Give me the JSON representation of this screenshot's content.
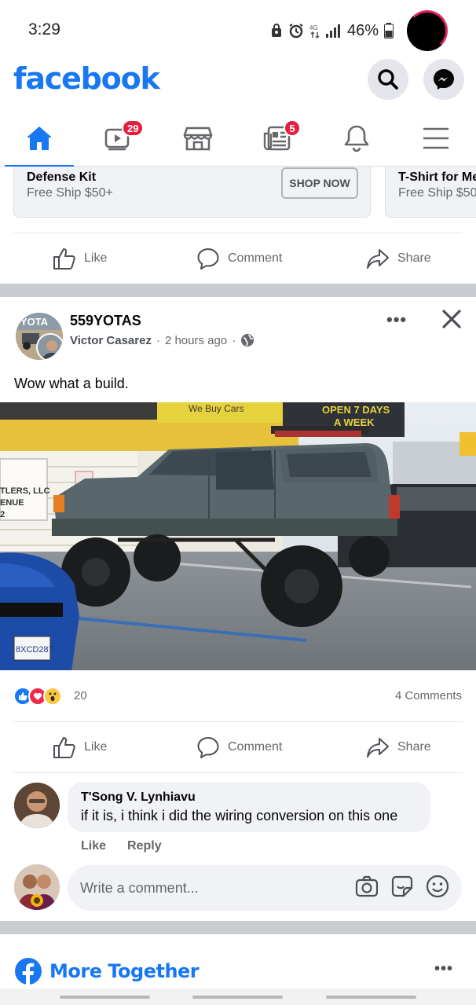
{
  "status_bar": {
    "time": "3:29",
    "battery": "46%",
    "icons": [
      "lock-icon",
      "alarm-icon",
      "data-icon",
      "signal-icon",
      "battery-icon"
    ]
  },
  "header": {
    "logo": "facebook",
    "brand_color": "#1877f2",
    "icons": [
      "search-icon",
      "messenger-icon"
    ]
  },
  "nav_tabs": [
    {
      "name": "home",
      "icon": "home-icon",
      "badge": "",
      "active": true
    },
    {
      "name": "watch",
      "icon": "video-icon",
      "badge": "29"
    },
    {
      "name": "marketplace",
      "icon": "marketplace-icon",
      "badge": ""
    },
    {
      "name": "news",
      "icon": "news-icon",
      "badge": "5"
    },
    {
      "name": "notifications",
      "icon": "bell-icon",
      "badge": ""
    },
    {
      "name": "menu",
      "icon": "menu-icon",
      "badge": ""
    }
  ],
  "ad_carousel": {
    "cards": [
      {
        "title": "Defense Kit",
        "subtitle": "Free Ship $50+",
        "cta": "SHOP NOW"
      },
      {
        "title": "T-Shirt for Me",
        "subtitle": "Free Ship $50"
      }
    ]
  },
  "actions": {
    "like": "Like",
    "comment": "Comment",
    "share": "Share"
  },
  "post": {
    "group": "559YOTAS",
    "author": "Victor Casarez",
    "time": "2 hours ago",
    "separator": "·",
    "text": "Wow what a build.",
    "photo": {
      "top_sign": "We Buy Cars",
      "dark_sign_1": "OPEN 7 DAYS",
      "dark_sign_2": "A WEEK",
      "wall_sign_1": "TLERS, LLC",
      "wall_sign_2": "ENUE",
      "wall_sign_3": "2",
      "plate": "8XCD287"
    },
    "reaction_count": "20",
    "comments_count": "4 Comments",
    "reactions": [
      "like-reaction-icon",
      "love-reaction-icon",
      "wow-reaction-icon"
    ]
  },
  "comment": {
    "name": "T'Song V. Lynhiavu",
    "text": "if it is, i think i did the wiring conversion on this one",
    "like": "Like",
    "reply": "Reply"
  },
  "write_comment": {
    "placeholder": "Write a comment...",
    "icons": [
      "camera-icon",
      "sticker-icon",
      "emoji-icon"
    ]
  },
  "more_together": {
    "title": "More Together"
  }
}
